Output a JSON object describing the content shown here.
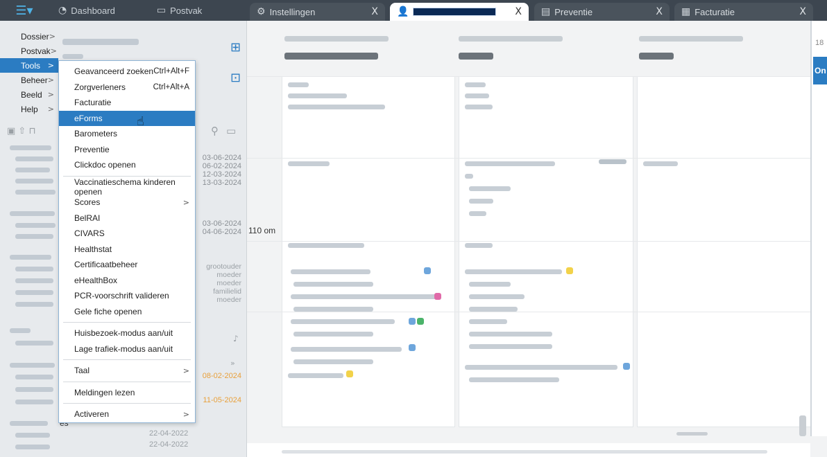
{
  "topbar": {
    "menu_icon": "hamburger-menu-icon",
    "nav": [
      {
        "label": "Dashboard",
        "icon": "speedometer-icon"
      },
      {
        "label": "Postvak",
        "icon": "inbox-icon"
      }
    ],
    "tabs": [
      {
        "label": "Instellingen",
        "icon": "gear-icon",
        "close": "X"
      },
      {
        "label": "",
        "icon": "person-icon",
        "close": "X"
      },
      {
        "label": "Preventie",
        "icon": "document-icon",
        "close": "X"
      },
      {
        "label": "Facturatie",
        "icon": "invoice-icon",
        "close": "X"
      }
    ]
  },
  "mainmenu": [
    {
      "label": "Dossier",
      "arrow": ">"
    },
    {
      "label": "Postvak",
      "arrow": ">"
    },
    {
      "label": "Tools",
      "arrow": ">"
    },
    {
      "label": "Beheer",
      "arrow": ">"
    },
    {
      "label": "Beeld",
      "arrow": ">"
    },
    {
      "label": "Help",
      "arrow": ">"
    }
  ],
  "tools_menu": [
    {
      "label": "Geavanceerd zoeken",
      "shortcut": "Ctrl+Alt+F"
    },
    {
      "label": "Zorgverleners",
      "shortcut": "Ctrl+Alt+A"
    },
    {
      "label": "Facturatie"
    },
    {
      "label": "eForms"
    },
    {
      "label": "Barometers"
    },
    {
      "label": "Preventie"
    },
    {
      "label": "Clickdoc openen"
    },
    {
      "label": "Vaccinatieschema kinderen openen"
    },
    {
      "label": "Scores",
      "arrow": ">"
    },
    {
      "label": "BelRAI"
    },
    {
      "label": "CIVARS"
    },
    {
      "label": "Healthstat"
    },
    {
      "label": "Certificaatbeheer"
    },
    {
      "label": "eHealthBox"
    },
    {
      "label": "PCR-voorschrift valideren"
    },
    {
      "label": "Gele fiche openen"
    },
    {
      "label": "Huisbezoek-modus aan/uit"
    },
    {
      "label": "Lage trafiek-modus aan/uit"
    },
    {
      "label": "Taal",
      "arrow": ">"
    },
    {
      "label": "Meldingen lezen"
    },
    {
      "label": "Activeren",
      "arrow": ">"
    }
  ],
  "sidebar": {
    "dates_a": [
      "03-06-2024",
      "06-02-2024",
      "12-03-2024",
      "13-03-2024"
    ],
    "dates_b": [
      "03-06-2024",
      "04-06-2024"
    ],
    "roles": [
      "grootouder",
      "moeder",
      "moeder",
      "familielid",
      "moeder"
    ],
    "date_c": "08-02-2024",
    "date_d": "11-05-2024",
    "bottom_dates": [
      "22-04-2022",
      "22-04-2022"
    ],
    "section_suffix": "es"
  },
  "main": {
    "time_label": "110 om",
    "right_edge_num": "18",
    "right_edge_badge": "On"
  }
}
